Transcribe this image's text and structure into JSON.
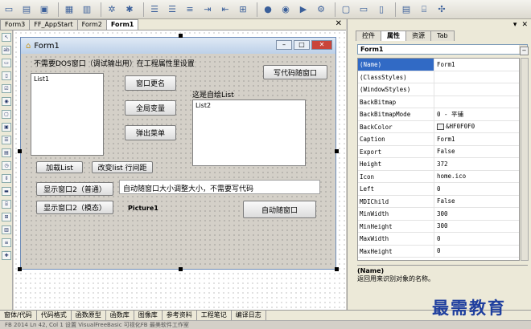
{
  "toolbar": {
    "icons": [
      "new-icon",
      "open-icon",
      "save-icon",
      "save-all-icon",
      "print-icon",
      "run-icon",
      "debug-icon",
      "align-left-icon",
      "align-right-icon",
      "align-center-icon",
      "indent-icon",
      "outdent-icon",
      "layout-icon",
      "record-icon",
      "stop-icon",
      "play-icon",
      "settings-icon",
      "window-icon",
      "dialog-icon",
      "comment-icon",
      "book-icon",
      "tree-icon",
      "tools-icon"
    ]
  },
  "doc_tabs": [
    "Form3",
    "FF_AppStart",
    "Form2",
    "Form1"
  ],
  "form": {
    "title": "Form1",
    "hint_label": "不需要DOS窗口（调试输出用）在工程属性里设置",
    "code_follow_button": "写代码随窗口",
    "list1": "List1",
    "rename_button": "窗口更名",
    "global_var_button": "全局变量",
    "popup_menu_button": "弹出菜单",
    "self_draw_label": "这是自绘List",
    "list2": "List2",
    "load_list_button": "加载List",
    "change_spacing_button": "改变list 行间距",
    "show_normal_button": "显示窗口2（普通）",
    "auto_resize_text": "自动随窗口大小调整大小，不需要写代码",
    "show_modal_button": "显示窗口2（模态）",
    "picture_label": "Picture1",
    "auto_follow_button": "自动随窗口"
  },
  "properties_panel": {
    "tabs": [
      "控件",
      "属性",
      "资源",
      "Tab"
    ],
    "object": "Form1",
    "rows": [
      {
        "k": "(Name)",
        "v": "Form1"
      },
      {
        "k": "(ClassStyles)",
        "v": ""
      },
      {
        "k": "(WindowStyles)",
        "v": ""
      },
      {
        "k": "BackBitmap",
        "v": ""
      },
      {
        "k": "BackBitmapMode",
        "v": "0 - 平铺"
      },
      {
        "k": "BackColor",
        "v": "&HF0F0F0"
      },
      {
        "k": "Caption",
        "v": "Form1"
      },
      {
        "k": "Export",
        "v": "False"
      },
      {
        "k": "Height",
        "v": "372"
      },
      {
        "k": "Icon",
        "v": "home.ico"
      },
      {
        "k": "Left",
        "v": "0"
      },
      {
        "k": "MDIChild",
        "v": "False"
      },
      {
        "k": "MinWidth",
        "v": "300"
      },
      {
        "k": "MinHeight",
        "v": "300"
      },
      {
        "k": "MaxWidth",
        "v": "0"
      },
      {
        "k": "MaxHeight",
        "v": "0"
      }
    ],
    "desc_title": "(Name)",
    "desc_text": "返回用来识别对象的名称。"
  },
  "bottom_tabs": [
    "窗体/代码",
    "代码格式",
    "函数原型",
    "函数库",
    "图像库",
    "参考资料",
    "工程笔记",
    "编译日志"
  ],
  "status": "FB 2014    Ln 42, Col 1    设置    VisualFreeBasic    可视化FB 最美软件工作室",
  "watermark": "最需教育"
}
